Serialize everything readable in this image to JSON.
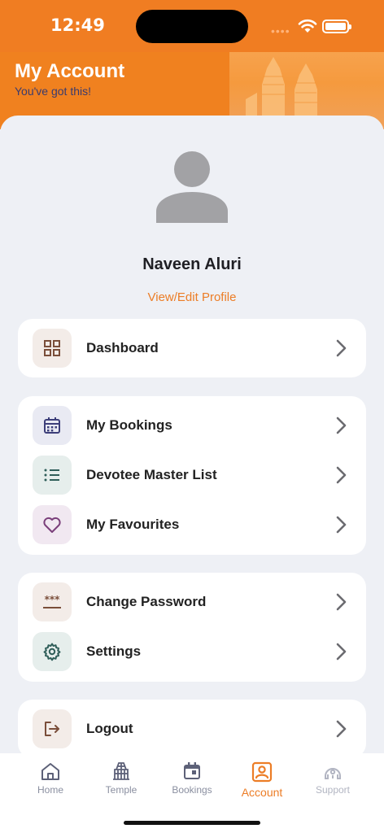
{
  "status": {
    "time": "12:49"
  },
  "header": {
    "title": "My Account",
    "subtitle": "You've got this!"
  },
  "profile": {
    "name": "Naveen Aluri",
    "edit_link": "View/Edit Profile"
  },
  "menu": {
    "dashboard": {
      "label": "Dashboard",
      "icon": "grid-icon"
    },
    "bookings": {
      "label": "My Bookings",
      "icon": "calendar-icon"
    },
    "devotees": {
      "label": "Devotee Master List",
      "icon": "list-icon"
    },
    "favourites": {
      "label": "My Favourites",
      "icon": "heart-icon"
    },
    "password": {
      "label": "Change Password",
      "icon": "password-icon"
    },
    "settings": {
      "label": "Settings",
      "icon": "gear-icon"
    },
    "logout": {
      "label": "Logout",
      "icon": "logout-icon"
    }
  },
  "tabs": [
    {
      "label": "Home",
      "icon": "home-icon"
    },
    {
      "label": "Temple",
      "icon": "temple-icon"
    },
    {
      "label": "Bookings",
      "icon": "calendar-icon"
    },
    {
      "label": "Account",
      "icon": "account-icon",
      "active": true
    },
    {
      "label": "Support",
      "icon": "support-icon"
    }
  ],
  "colors": {
    "primary": "#f07d22",
    "accent_text": "#ec7d26",
    "background": "#eef0f5"
  }
}
